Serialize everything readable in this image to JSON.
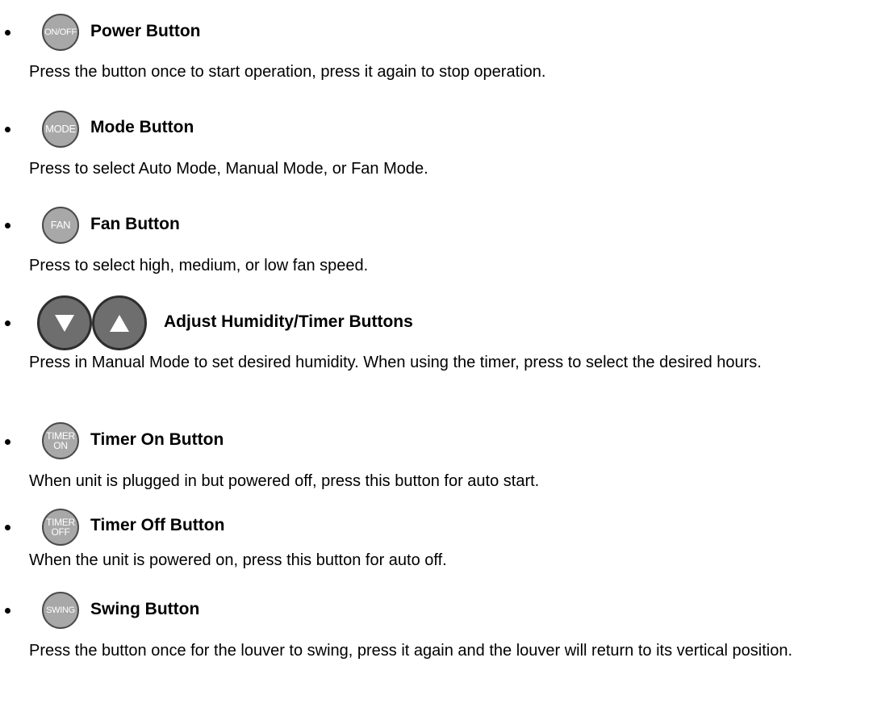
{
  "items": [
    {
      "icon_label": "ON/OFF",
      "title": "Power Button",
      "description": "Press the button once to start operation, press it again to stop operation."
    },
    {
      "icon_label": "MODE",
      "title": "Mode Button",
      "description": "Press to select Auto Mode, Manual Mode, or Fan Mode."
    },
    {
      "icon_label": "FAN",
      "title": "Fan Button",
      "description": "Press to select high, medium, or low fan speed."
    },
    {
      "icon_label": "",
      "title": "Adjust Humidity/Timer Buttons",
      "description": "Press in Manual Mode to set desired humidity. When using the timer, press to select the desired hours."
    },
    {
      "icon_label_top": "TIMER",
      "icon_label_bottom": "ON",
      "title": "Timer On Button",
      "description": "When unit is plugged in but powered off, press this button for auto start."
    },
    {
      "icon_label_top": "TIMER",
      "icon_label_bottom": "OFF",
      "title": "Timer Off Button",
      "description": "When the unit is powered on, press this button for auto off."
    },
    {
      "icon_label": "SWING",
      "title": "Swing Button",
      "description": "Press the button once for the louver to swing, press it again and the louver will return to its vertical position."
    }
  ],
  "colors": {
    "button_fill": "#a8a8a8",
    "arrow_button_fill": "#6e6e6e",
    "text": "#000000"
  },
  "icons": [
    "on-off-icon",
    "mode-icon",
    "fan-icon",
    "down-arrow-icon",
    "up-arrow-icon",
    "timer-on-icon",
    "timer-off-icon",
    "swing-icon"
  ]
}
